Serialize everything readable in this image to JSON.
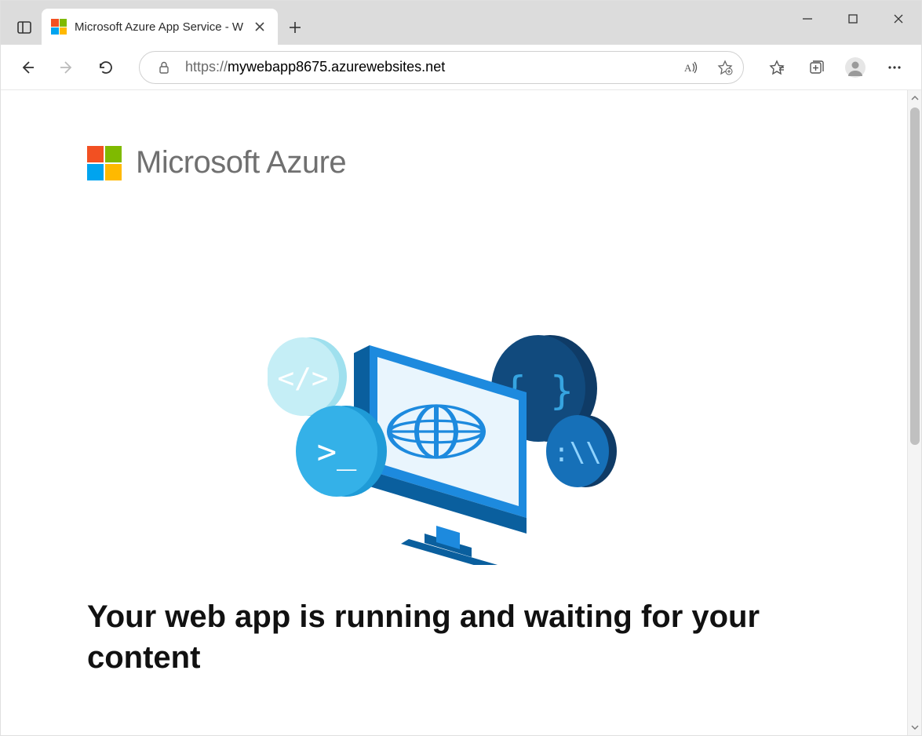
{
  "browser": {
    "tab_title": "Microsoft Azure App Service - W",
    "url_display": "mywebapp8675.azurewebsites.net",
    "url_protocol": "https://"
  },
  "page": {
    "brand": "Microsoft Azure",
    "heading": "Your web app is running and waiting for your content"
  }
}
